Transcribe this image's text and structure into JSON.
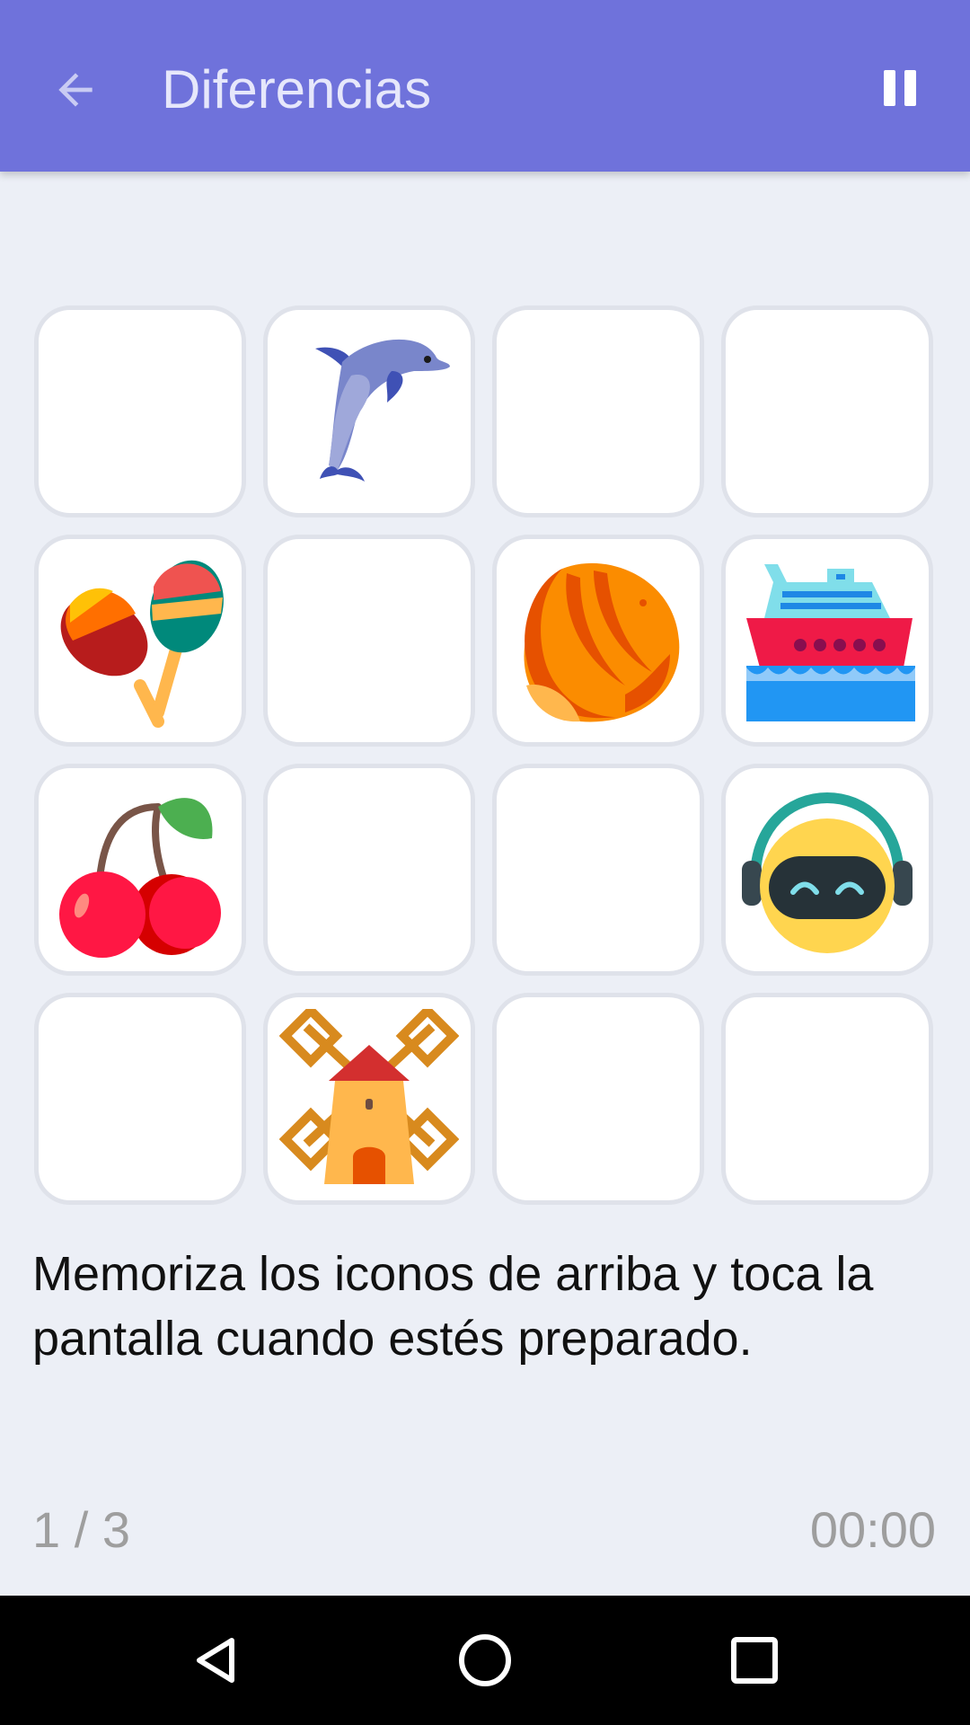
{
  "app_bar": {
    "title": "Diferencias",
    "back_icon": "arrow-back-icon",
    "pause_icon": "pause-icon",
    "color": "#6F72DB"
  },
  "grid": {
    "rows": 4,
    "columns": 4,
    "tiles": [
      {
        "icon": ""
      },
      {
        "icon": "dolphin-icon"
      },
      {
        "icon": ""
      },
      {
        "icon": ""
      },
      {
        "icon": "maracas-icon"
      },
      {
        "icon": ""
      },
      {
        "icon": "hazelnut-icon"
      },
      {
        "icon": "cruise-ship-icon"
      },
      {
        "icon": "cherries-icon"
      },
      {
        "icon": ""
      },
      {
        "icon": ""
      },
      {
        "icon": "robot-headphones-icon"
      },
      {
        "icon": ""
      },
      {
        "icon": "windmill-icon"
      },
      {
        "icon": ""
      },
      {
        "icon": ""
      }
    ]
  },
  "instruction": "Memoriza los iconos de arriba y toca la pantalla cuando estés preparado.",
  "footer": {
    "progress": "1 / 3",
    "timer": "00:00"
  },
  "system_nav": {
    "back": "nav-back-icon",
    "home": "nav-home-icon",
    "recents": "nav-recents-icon"
  }
}
